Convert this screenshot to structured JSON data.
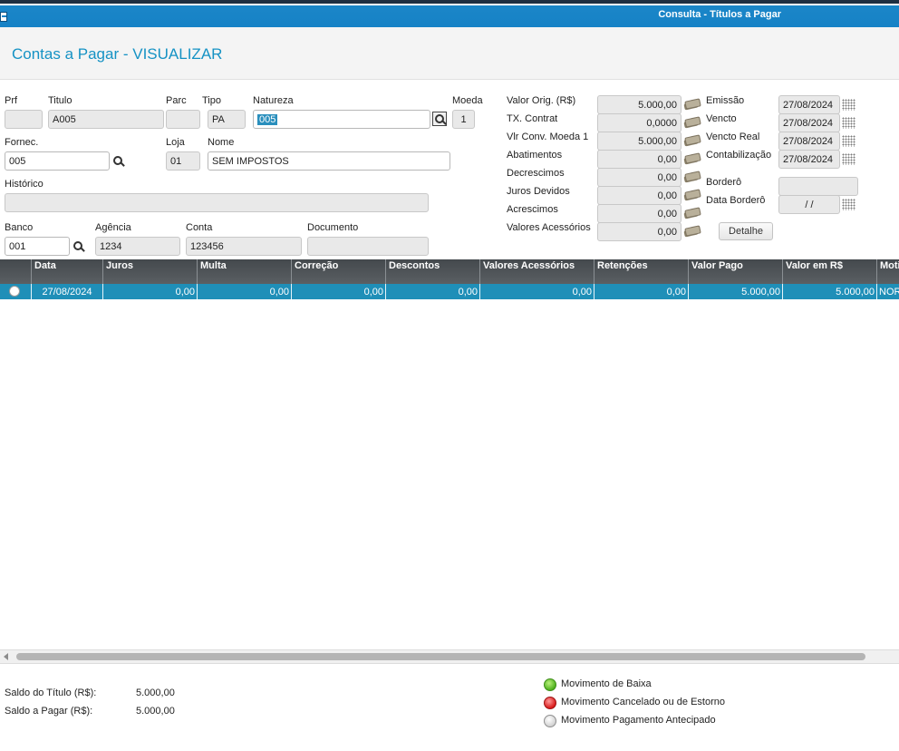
{
  "window": {
    "title": "Consulta - Títulos a Pagar"
  },
  "page": {
    "title": "Contas a Pagar - VISUALIZAR"
  },
  "fields": {
    "prf": {
      "label": "Prf",
      "value": ""
    },
    "titulo": {
      "label": "Titulo",
      "value": "A005"
    },
    "parc": {
      "label": "Parc",
      "value": ""
    },
    "tipo": {
      "label": "Tipo",
      "value": "PA"
    },
    "natureza": {
      "label": "Natureza",
      "value": "005"
    },
    "moeda": {
      "label": "Moeda",
      "value": "1"
    },
    "fornec": {
      "label": "Fornec.",
      "value": "005"
    },
    "loja": {
      "label": "Loja",
      "value": "01"
    },
    "nome": {
      "label": "Nome",
      "value": "SEM IMPOSTOS"
    },
    "historico": {
      "label": "Histórico",
      "value": ""
    },
    "banco": {
      "label": "Banco",
      "value": "001"
    },
    "agencia": {
      "label": "Agência",
      "value": "1234"
    },
    "conta": {
      "label": "Conta",
      "value": "123456"
    },
    "documento": {
      "label": "Documento",
      "value": ""
    }
  },
  "values": [
    {
      "label": "Valor Orig. (R$)",
      "value": "5.000,00"
    },
    {
      "label": "TX. Contrat",
      "value": "0,0000"
    },
    {
      "label": "Vlr Conv. Moeda 1",
      "value": "5.000,00"
    },
    {
      "label": "Abatimentos",
      "value": "0,00"
    },
    {
      "label": "Decrescimos",
      "value": "0,00"
    },
    {
      "label": "Juros Devidos",
      "value": "0,00"
    },
    {
      "label": "Acrescimos",
      "value": "0,00"
    },
    {
      "label": "Valores Acessórios",
      "value": "0,00"
    }
  ],
  "dates": {
    "emissao": {
      "label": "Emissão",
      "value": "27/08/2024"
    },
    "vencto": {
      "label": "Vencto",
      "value": "27/08/2024"
    },
    "vencto_real": {
      "label": "Vencto Real",
      "value": "27/08/2024"
    },
    "contabilizacao": {
      "label": "Contabilização",
      "value": "27/08/2024"
    },
    "bordero": {
      "label": "Borderô",
      "value": ""
    },
    "data_bordero": {
      "label": "Data Borderô",
      "value": " /  / "
    }
  },
  "buttons": {
    "detalhe": "Detalhe"
  },
  "grid": {
    "columns": [
      "",
      "Data",
      "Juros",
      "Multa",
      "Correção",
      "Descontos",
      "Valores Acessórios",
      "Retenções",
      "Valor Pago",
      "Valor em R$",
      "Moti"
    ],
    "rows": [
      [
        "",
        "27/08/2024",
        "0,00",
        "0,00",
        "0,00",
        "0,00",
        "0,00",
        "0,00",
        "5.000,00",
        "5.000,00",
        "NOR"
      ]
    ]
  },
  "footer": {
    "saldo_titulo": {
      "label": "Saldo do Título (R$):",
      "value": "5.000,00"
    },
    "saldo_pagar": {
      "label": "Saldo a Pagar (R$):",
      "value": "5.000,00"
    }
  },
  "legend": [
    {
      "label": "Movimento de Baixa",
      "icon": "green-status-icon",
      "color": "#4fb11e"
    },
    {
      "label": "Movimento Cancelado ou de Estorno",
      "icon": "red-status-icon",
      "color": "#d81a1a"
    },
    {
      "label": "Movimento Pagamento Antecipado",
      "icon": "grey-status-icon",
      "color": "#cfcfcf"
    }
  ]
}
